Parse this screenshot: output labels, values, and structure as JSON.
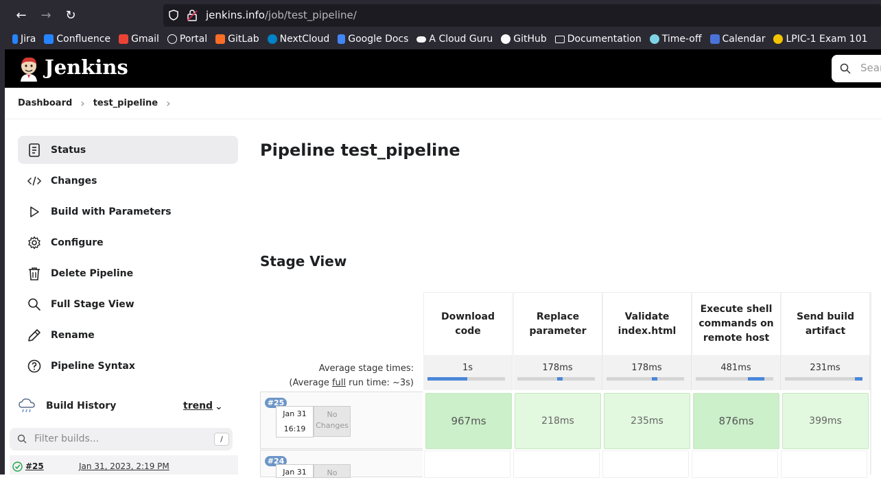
{
  "browser": {
    "url_host": "jenkins.info",
    "url_path": "/job/test_pipeline/",
    "bookmarks": [
      "Jira",
      "Confluence",
      "Gmail",
      "Portal",
      "GitLab",
      "NextCloud",
      "Google Docs",
      "A Cloud Guru",
      "GitHub",
      "Documentation",
      "Time-off",
      "Calendar",
      "LPIC-1 Exam 101"
    ]
  },
  "header": {
    "title": "Jenkins",
    "search_placeholder": "Sear"
  },
  "breadcrumb": [
    "Dashboard",
    "test_pipeline"
  ],
  "sidebar": {
    "items": [
      {
        "label": "Status",
        "icon": "document-icon",
        "active": true
      },
      {
        "label": "Changes",
        "icon": "code-icon"
      },
      {
        "label": "Build with Parameters",
        "icon": "play-icon"
      },
      {
        "label": "Configure",
        "icon": "gear-icon"
      },
      {
        "label": "Delete Pipeline",
        "icon": "trash-icon"
      },
      {
        "label": "Full Stage View",
        "icon": "search-icon"
      },
      {
        "label": "Rename",
        "icon": "pencil-icon"
      },
      {
        "label": "Pipeline Syntax",
        "icon": "help-icon"
      }
    ]
  },
  "build_history": {
    "title": "Build History",
    "trend": "trend",
    "filter_placeholder": "Filter builds...",
    "filter_shortcut": "/",
    "builds": [
      {
        "number": "#25",
        "date": "Jan 31, 2023, 2:19 PM"
      }
    ]
  },
  "main": {
    "title": "Pipeline test_pipeline",
    "stage_view_title": "Stage View",
    "avg_label": "Average stage times:",
    "avg_full_prefix": "(Average ",
    "avg_full_word": "full",
    "avg_full_suffix": " run time: ~3s)"
  },
  "stages": [
    {
      "name": "Download code",
      "avg": "1s",
      "avg_fill": 0.5
    },
    {
      "name": "Replace parameter",
      "avg": "178ms",
      "avg_fill": 0.08
    },
    {
      "name": "Validate index.html",
      "avg": "178ms",
      "avg_fill": 0.08
    },
    {
      "name": "Execute shell commands on remote host",
      "avg": "481ms",
      "avg_fill": 0.2
    },
    {
      "name": "Send build artifact",
      "avg": "231ms",
      "avg_fill": 0.1
    }
  ],
  "runs": [
    {
      "badge": "#25",
      "date": "Jan 31",
      "time": "16:19",
      "changes": "No Changes",
      "times": [
        "967ms",
        "218ms",
        "235ms",
        "876ms",
        "399ms"
      ]
    },
    {
      "badge": "#24",
      "date": "Jan 31",
      "time": "",
      "changes": "No",
      "times": [
        "",
        "",
        "",
        "",
        ""
      ]
    }
  ]
}
